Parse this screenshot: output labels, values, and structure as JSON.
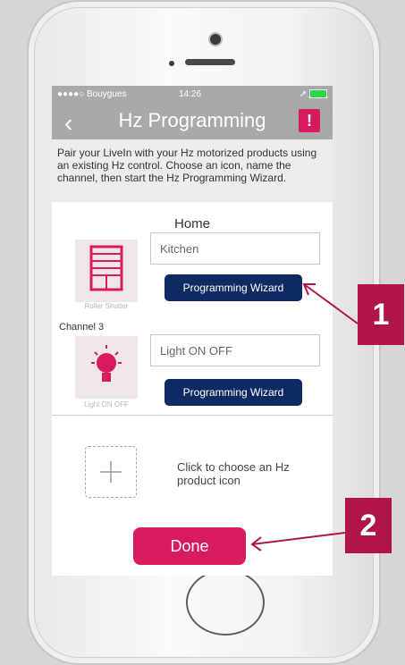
{
  "status_bar": {
    "carrier": "●●●●○ Bouygues",
    "time": "14:26",
    "right": "➚"
  },
  "nav": {
    "title": "Hz Programming",
    "alert": "!"
  },
  "intro_text": "Pair your LiveIn with your Hz motorized products using an existing Hz control. Choose an icon, name the channel, then start the Hz Programming Wizard.",
  "section_title": "Home",
  "channels": [
    {
      "name_value": "Kitchen",
      "icon_caption": "Roller Shutter",
      "icon": "roller-shutter-icon",
      "button": "Programming Wizard"
    },
    {
      "label": "Channel 3",
      "name_value": "Light ON OFF",
      "icon_caption": "Light ON OFF",
      "icon": "light-bulb-icon",
      "button": "Programming Wizard"
    }
  ],
  "add_product_text": "Click to choose an Hz product icon",
  "done_label": "Done",
  "callouts": [
    {
      "label": "1"
    },
    {
      "label": "2"
    }
  ],
  "colors": {
    "accent": "#d81b60",
    "navy": "#0f2a62",
    "callout": "#b0154a"
  }
}
